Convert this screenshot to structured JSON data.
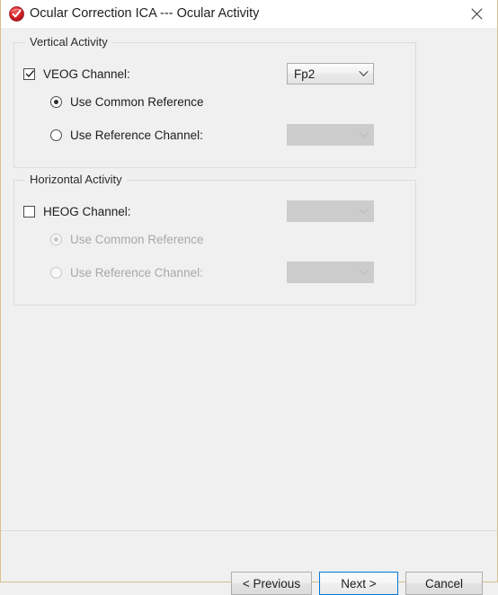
{
  "window": {
    "title": "Ocular Correction ICA --- Ocular Activity",
    "app_icon": "ocular-ica-icon",
    "close_icon": "close-icon",
    "accent_color": "#0078d7",
    "frame_border_color": "#d9c08a",
    "background_color": "#f0f0f0"
  },
  "vertical_group": {
    "label": "Vertical Activity",
    "channel_checkbox": {
      "label": "VEOG Channel:",
      "checked": true,
      "enabled": true
    },
    "channel_combo": {
      "value": "Fp2",
      "enabled": true,
      "arrow_icon": "chevron-down-icon"
    },
    "common_reference_radio": {
      "label": "Use Common Reference",
      "selected": true,
      "enabled": true
    },
    "reference_channel_radio": {
      "label": "Use Reference Channel:",
      "selected": false,
      "enabled": true
    },
    "reference_combo": {
      "value": "",
      "enabled": false,
      "arrow_icon": "chevron-down-icon"
    }
  },
  "horizontal_group": {
    "label": "Horizontal Activity",
    "channel_checkbox": {
      "label": "HEOG Channel:",
      "checked": false,
      "enabled": true
    },
    "channel_combo": {
      "value": "",
      "enabled": false,
      "arrow_icon": "chevron-down-icon"
    },
    "common_reference_radio": {
      "label": "Use Common Reference",
      "selected": true,
      "enabled": false
    },
    "reference_channel_radio": {
      "label": "Use Reference Channel:",
      "selected": false,
      "enabled": false
    },
    "reference_combo": {
      "value": "",
      "enabled": false,
      "arrow_icon": "chevron-down-icon"
    }
  },
  "buttons": {
    "previous": "< Previous",
    "next": "Next >",
    "cancel": "Cancel",
    "default_button": "next"
  }
}
